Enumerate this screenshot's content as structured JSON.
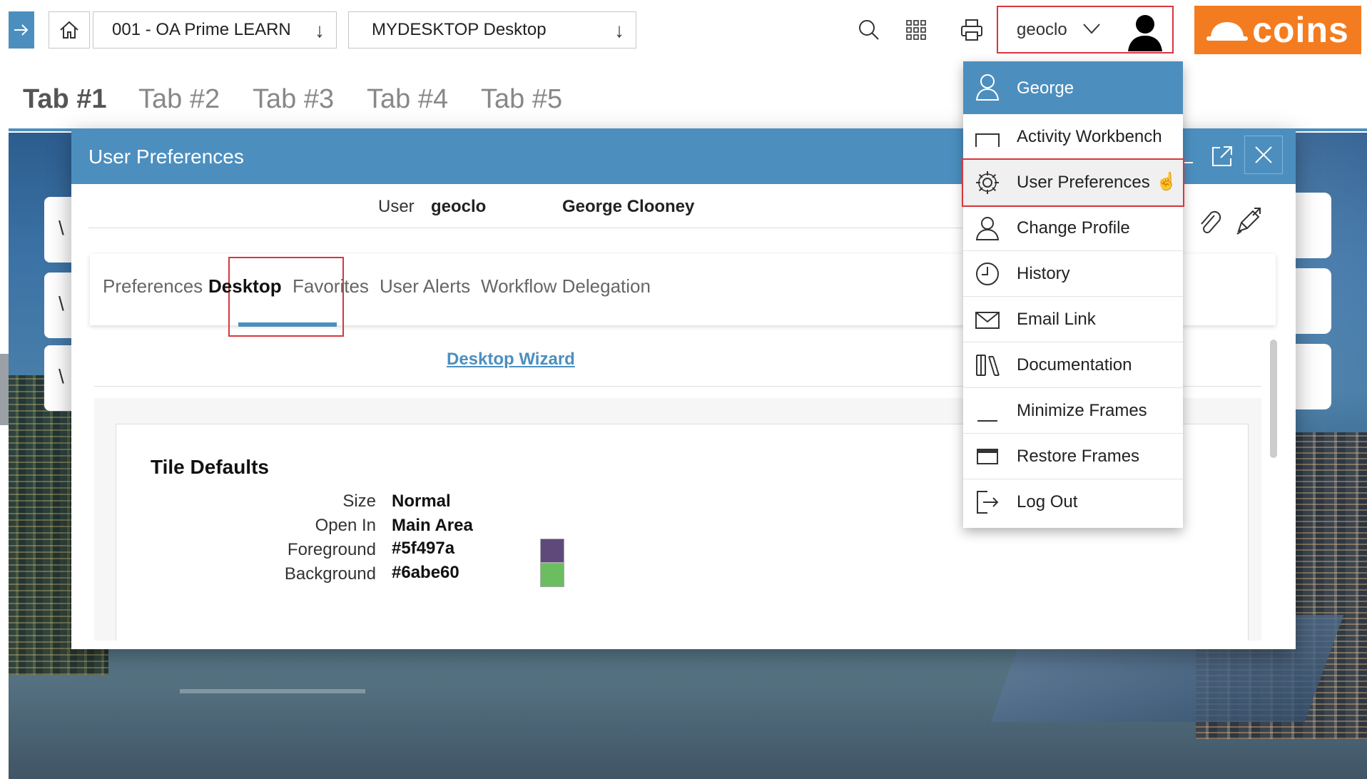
{
  "breadcrumb": {
    "company": "001 - OA Prime LEARN",
    "desktop": "MYDESKTOP Desktop"
  },
  "user_menu": {
    "username": "geoclo"
  },
  "logo": {
    "text": "coins",
    "color": "#f47c20"
  },
  "desktop_tabs": [
    "Tab #1",
    "Tab #2",
    "Tab #3",
    "Tab #4",
    "Tab #5"
  ],
  "dialog": {
    "title": "User Preferences",
    "user_label": "User",
    "user_id": "geoclo",
    "user_full_name": "George Clooney",
    "tabs": [
      "Preferences",
      "Desktop",
      "Favorites",
      "User Alerts",
      "Workflow Delegation"
    ],
    "active_tab": "Desktop",
    "wizard_link": "Desktop Wizard",
    "tile_defaults": {
      "title": "Tile Defaults",
      "size_label": "Size",
      "size_value": "Normal",
      "open_in_label": "Open In",
      "open_in_value": "Main Area",
      "foreground_label": "Foreground",
      "foreground_value": "#5f497a",
      "background_label": "Background",
      "background_value": "#6abe60"
    }
  },
  "dropdown": {
    "header_name": "George",
    "items": [
      {
        "label": "Activity Workbench",
        "icon": "frame-icon"
      },
      {
        "label": "User Preferences",
        "icon": "gear-icon"
      },
      {
        "label": "Change Profile",
        "icon": "person-icon"
      },
      {
        "label": "History",
        "icon": "clock-icon"
      },
      {
        "label": "Email Link",
        "icon": "envelope-icon"
      },
      {
        "label": "Documentation",
        "icon": "books-icon"
      },
      {
        "label": "Minimize Frames",
        "icon": "minimize-icon"
      },
      {
        "label": "Restore Frames",
        "icon": "restore-icon"
      },
      {
        "label": "Log Out",
        "icon": "logout-icon"
      }
    ]
  },
  "colors": {
    "accent": "#4c8fbf",
    "highlight_border": "#d9363e"
  }
}
